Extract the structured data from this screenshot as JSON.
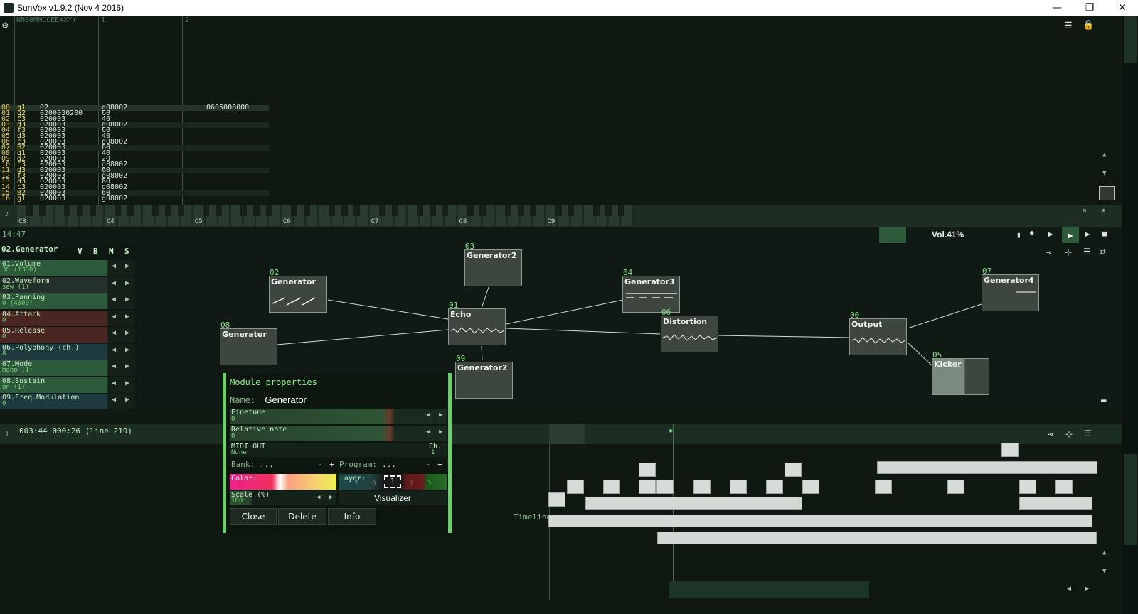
{
  "window": {
    "title": "SunVox v1.9.2 (Nov  4 2016)",
    "minimize": "—",
    "maximize": "❐",
    "close": "✕"
  },
  "pattern": {
    "header_text": "NN00MMCCEEXXYY",
    "track_labels": [
      "1",
      "2"
    ],
    "rows": [
      {
        "n": "00",
        "note": "g1",
        "c1": "02",
        "c2": "g08002",
        "c3": "0605008000"
      },
      {
        "n": "01",
        "note": "g2",
        "c1": "0200030200",
        "c2": "60",
        "c3": ""
      },
      {
        "n": "02",
        "note": "c3",
        "c1": "020003",
        "c2": "40",
        "c3": ""
      },
      {
        "n": "03",
        "note": "d3",
        "c1": "020003",
        "c2": "g08002",
        "c3": ""
      },
      {
        "n": "04",
        "note": "f3",
        "c1": "020003",
        "c2": "60",
        "c3": ""
      },
      {
        "n": "05",
        "note": "d3",
        "c1": "020003",
        "c2": "40",
        "c3": ""
      },
      {
        "n": "06",
        "note": "c3",
        "c1": "020003",
        "c2": "g08002",
        "c3": ""
      },
      {
        "n": "07",
        "note": "B2",
        "c1": "020003",
        "c2": "60",
        "c3": ""
      },
      {
        "n": "08",
        "note": "g1",
        "c1": "020003",
        "c2": "40",
        "c3": ""
      },
      {
        "n": "09",
        "note": "g2",
        "c1": "020003",
        "c2": "20",
        "c3": ""
      },
      {
        "n": "10",
        "note": "c3",
        "c1": "020003",
        "c2": "g08002",
        "c3": ""
      },
      {
        "n": "11",
        "note": "d3",
        "c1": "020003",
        "c2": "60",
        "c3": ""
      },
      {
        "n": "12",
        "note": "f3",
        "c1": "020003",
        "c2": "g08002",
        "c3": ""
      },
      {
        "n": "13",
        "note": "d3",
        "c1": "020003",
        "c2": "60",
        "c3": ""
      },
      {
        "n": "14",
        "note": "c3",
        "c1": "020003",
        "c2": "g08002",
        "c3": ""
      },
      {
        "n": "15",
        "note": "B2",
        "c1": "020003",
        "c2": "60",
        "c3": ""
      },
      {
        "n": "16",
        "note": "g1",
        "c1": "020003",
        "c2": "g08002",
        "c3": ""
      }
    ]
  },
  "keyboard": {
    "octave_labels": [
      "C3",
      "C4",
      "C5",
      "C6",
      "C7",
      "C8",
      "C9"
    ]
  },
  "status": {
    "time": "14:47",
    "volume": "Vol.41%"
  },
  "controllers": {
    "module_title": "02.Generator",
    "flags": [
      "V",
      "B",
      "M",
      "S"
    ],
    "items": [
      {
        "name": "01.Volume",
        "value": "38 (1300)",
        "color": "#2c5a3a"
      },
      {
        "name": "02.Waveform",
        "value": "saw (1)",
        "color": "#24302a"
      },
      {
        "name": "03.Panning",
        "value": "0 (4000)",
        "color": "#2c5a3a"
      },
      {
        "name": "04.Attack",
        "value": "0",
        "color": "#4a2622"
      },
      {
        "name": "05.Release",
        "value": "0",
        "color": "#4a2622"
      },
      {
        "name": "06.Polyphony (ch.)",
        "value": "8",
        "color": "#1f3a3e"
      },
      {
        "name": "07.Mode",
        "value": "mono (1)",
        "color": "#2c5a3a"
      },
      {
        "name": "08.Sustain",
        "value": "on (1)",
        "color": "#2c5a3a"
      },
      {
        "name": "09.Freq.Modulation",
        "value": "0",
        "color": "#1f3a3e"
      }
    ]
  },
  "modules": [
    {
      "num": "02",
      "name": "Generator"
    },
    {
      "num": "08",
      "name": "Generator"
    },
    {
      "num": "03",
      "name": "Generator2"
    },
    {
      "num": "01",
      "name": "Echo"
    },
    {
      "num": "09",
      "name": "Generator2"
    },
    {
      "num": "04",
      "name": "Generator3"
    },
    {
      "num": "06",
      "name": "Distortion"
    },
    {
      "num": "00",
      "name": "Output"
    },
    {
      "num": "07",
      "name": "Generator4"
    },
    {
      "num": "05",
      "name": "Kicker"
    }
  ],
  "timeline": {
    "position": "003:44 000:26 (line 219)",
    "label": "Timeline:"
  },
  "dialog": {
    "title": "Module properties",
    "name_label": "Name:",
    "name_value": "Generator",
    "finetune_label": "Finetune",
    "finetune_value": "0",
    "relnote_label": "Relative note",
    "relnote_value": "0",
    "midi_label": "MIDI OUT",
    "midi_value": "None",
    "ch_label": "Ch.",
    "ch_value": "1",
    "bank_label": "Bank:",
    "bank_value": "...",
    "program_label": "Program:",
    "program_value": "...",
    "color_label": "Color:",
    "layer_label": "Layer:",
    "layers": [
      "7",
      "8",
      "1",
      "2",
      "3"
    ],
    "scale_label": "Scale (%)",
    "scale_value": "100",
    "visualizer": "Visualizer",
    "close": "Close",
    "delete": "Delete",
    "info": "Info",
    "minus": "-",
    "plus": "+"
  },
  "colors": {
    "background": "#0f1a13",
    "accent_green": "#6ad06a",
    "module_fill": "#3e4640"
  }
}
